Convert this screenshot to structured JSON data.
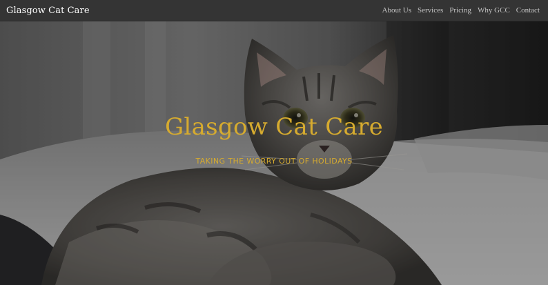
{
  "navbar": {
    "brand": "Glasgow Cat Care",
    "links": [
      {
        "label": "About Us"
      },
      {
        "label": "Services"
      },
      {
        "label": "Pricing"
      },
      {
        "label": "Why GCC"
      },
      {
        "label": "Contact"
      }
    ]
  },
  "hero": {
    "title": "Glasgow Cat Care",
    "subtitle": "TAKING THE WORRY OUT OF HOLIDAYS",
    "image": "tabby-cat-on-bed-photo"
  },
  "colors": {
    "navbar_bg": "#343434",
    "accent_gold": "#d6ab2f",
    "nav_text": "#c4c4c4",
    "brand_text": "#ffffff"
  }
}
